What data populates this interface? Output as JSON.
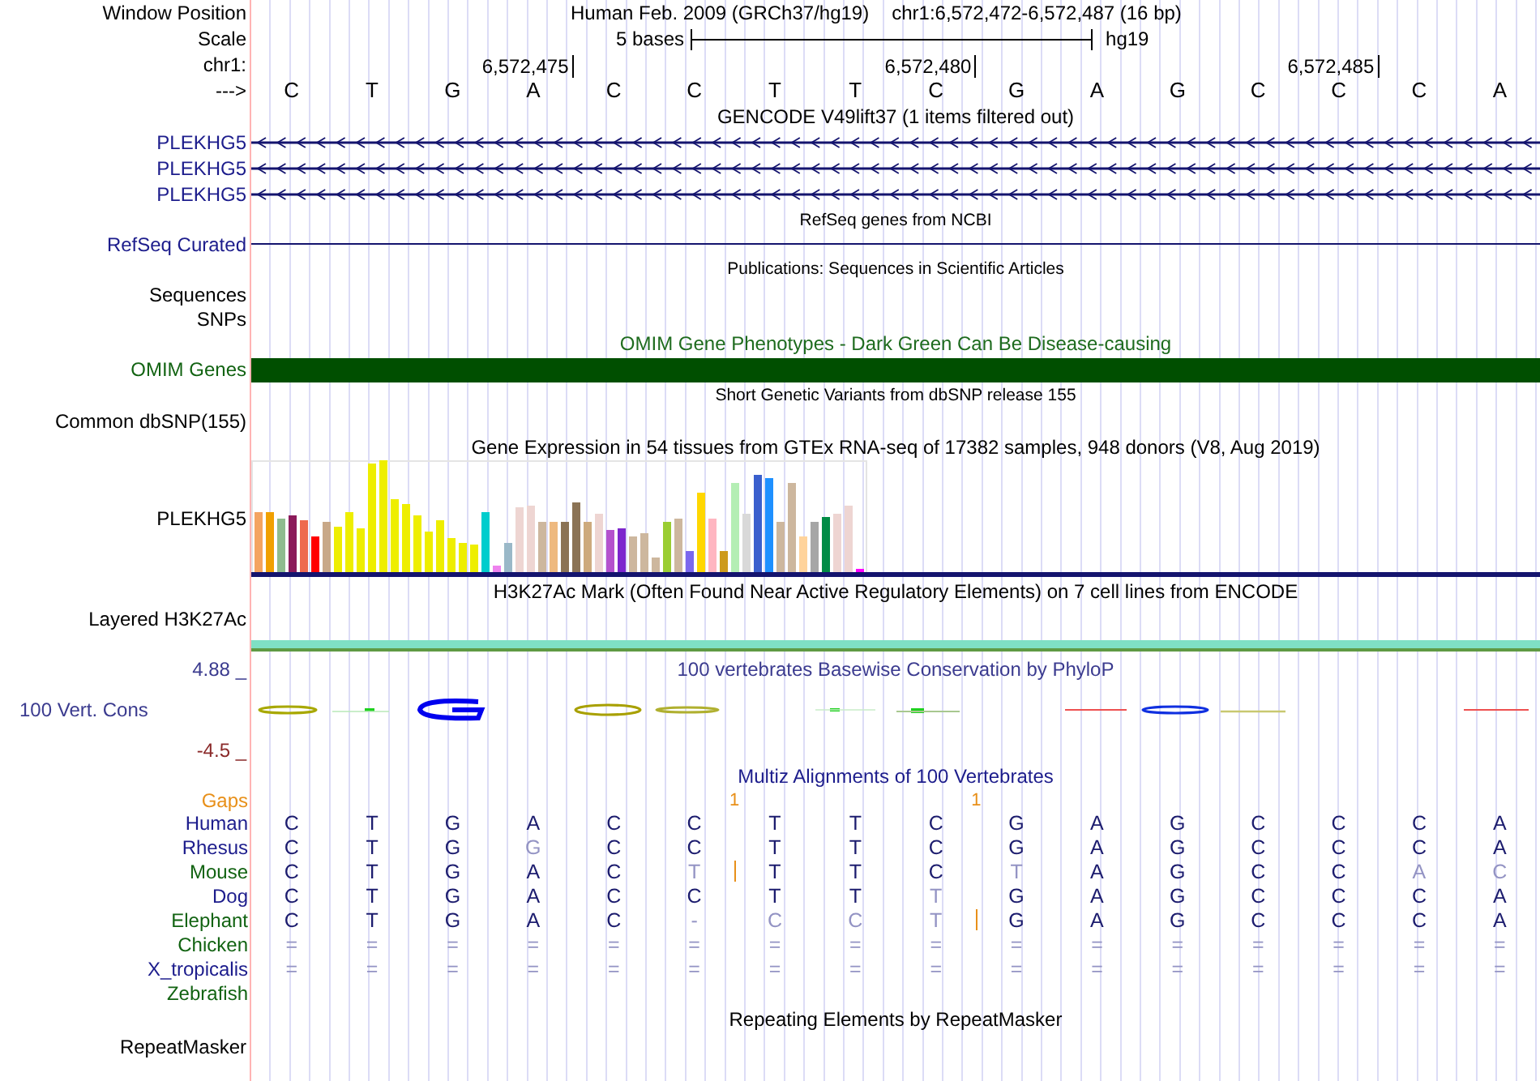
{
  "header": {
    "label": "Window Position",
    "assembly": "Human Feb. 2009 (GRCh37/hg19)",
    "range": "chr1:6,572,472-6,572,487 (16 bp)"
  },
  "scale": {
    "label": "Scale",
    "span": "5 bases",
    "assembly": "hg19"
  },
  "coordinates": {
    "label": "chr1:",
    "ticks": [
      "6,572,475",
      "6,572,480",
      "6,572,485"
    ]
  },
  "reference": {
    "label": "--->",
    "bases": [
      "C",
      "T",
      "G",
      "A",
      "C",
      "C",
      "T",
      "T",
      "C",
      "G",
      "A",
      "G",
      "C",
      "C",
      "C",
      "A"
    ]
  },
  "gencode": {
    "title": "GENCODE V49lift37 (1 items filtered out)",
    "transcripts": [
      {
        "name": "PLEKHG5"
      },
      {
        "name": "PLEKHG5"
      },
      {
        "name": "PLEKHG5"
      }
    ]
  },
  "refseq": {
    "title": "RefSeq genes from NCBI",
    "label": "RefSeq Curated"
  },
  "publications": {
    "title": "Publications: Sequences in Scientific Articles",
    "labels": [
      "Sequences",
      "SNPs"
    ]
  },
  "omim": {
    "title": "OMIM Gene Phenotypes - Dark Green Can Be Disease-causing",
    "label": "OMIM Genes"
  },
  "dbsnp": {
    "title": "Short Genetic Variants from dbSNP release 155",
    "label": "Common dbSNP(155)"
  },
  "gtex": {
    "title": "Gene Expression in 54 tissues from GTEx RNA-seq of 17382 samples, 948 donors (V8, Aug 2019)",
    "label": "PLEKHG5"
  },
  "h3k27ac": {
    "title": "H3K27Ac Mark (Often Found Near Active Regulatory Elements) on 7 cell lines from ENCODE",
    "label": "Layered H3K27Ac"
  },
  "phylop": {
    "title": "100 vertebrates Basewise Conservation by PhyloP",
    "label": "100 Vert. Cons",
    "max": "4.88 _",
    "min": "-4.5 _"
  },
  "multiz": {
    "title": "Multiz Alignments of 100 Vertebrates",
    "gaps": {
      "label": "Gaps",
      "color": "#e8901a",
      "marks": [
        "1",
        "1"
      ]
    },
    "species": [
      {
        "name": "Human",
        "color": "#1c1c8c",
        "bases": [
          {
            "b": "C",
            "dim": false,
            "ins": false
          },
          {
            "b": "T",
            "dim": false,
            "ins": false
          },
          {
            "b": "G",
            "dim": false,
            "ins": false
          },
          {
            "b": "A",
            "dim": false,
            "ins": false
          },
          {
            "b": "C",
            "dim": false,
            "ins": false
          },
          {
            "b": "C",
            "dim": false,
            "ins": false
          },
          {
            "b": "T",
            "dim": false,
            "ins": false
          },
          {
            "b": "T",
            "dim": false,
            "ins": false
          },
          {
            "b": "C",
            "dim": false,
            "ins": false
          },
          {
            "b": "G",
            "dim": false,
            "ins": false
          },
          {
            "b": "A",
            "dim": false,
            "ins": false
          },
          {
            "b": "G",
            "dim": false,
            "ins": false
          },
          {
            "b": "C",
            "dim": false,
            "ins": false
          },
          {
            "b": "C",
            "dim": false,
            "ins": false
          },
          {
            "b": "C",
            "dim": false,
            "ins": false
          },
          {
            "b": "A",
            "dim": false,
            "ins": false
          }
        ]
      },
      {
        "name": "Rhesus",
        "color": "#1c1c8c",
        "bases": [
          {
            "b": "C",
            "dim": false,
            "ins": false
          },
          {
            "b": "T",
            "dim": false,
            "ins": false
          },
          {
            "b": "G",
            "dim": false,
            "ins": false
          },
          {
            "b": "G",
            "dim": true,
            "ins": false
          },
          {
            "b": "C",
            "dim": false,
            "ins": false
          },
          {
            "b": "C",
            "dim": false,
            "ins": false
          },
          {
            "b": "T",
            "dim": false,
            "ins": false
          },
          {
            "b": "T",
            "dim": false,
            "ins": false
          },
          {
            "b": "C",
            "dim": false,
            "ins": false
          },
          {
            "b": "G",
            "dim": false,
            "ins": false
          },
          {
            "b": "A",
            "dim": false,
            "ins": false
          },
          {
            "b": "G",
            "dim": false,
            "ins": false
          },
          {
            "b": "C",
            "dim": false,
            "ins": false
          },
          {
            "b": "C",
            "dim": false,
            "ins": false
          },
          {
            "b": "C",
            "dim": false,
            "ins": false
          },
          {
            "b": "A",
            "dim": false,
            "ins": false
          }
        ]
      },
      {
        "name": "Mouse",
        "color": "#126312",
        "bases": [
          {
            "b": "C",
            "dim": false,
            "ins": false
          },
          {
            "b": "T",
            "dim": false,
            "ins": false
          },
          {
            "b": "G",
            "dim": false,
            "ins": false
          },
          {
            "b": "A",
            "dim": false,
            "ins": false
          },
          {
            "b": "C",
            "dim": false,
            "ins": false
          },
          {
            "b": "T",
            "dim": true,
            "ins": true
          },
          {
            "b": "T",
            "dim": false,
            "ins": false
          },
          {
            "b": "T",
            "dim": false,
            "ins": false
          },
          {
            "b": "C",
            "dim": false,
            "ins": false
          },
          {
            "b": "T",
            "dim": true,
            "ins": false
          },
          {
            "b": "A",
            "dim": false,
            "ins": false
          },
          {
            "b": "G",
            "dim": false,
            "ins": false
          },
          {
            "b": "C",
            "dim": false,
            "ins": false
          },
          {
            "b": "C",
            "dim": false,
            "ins": false
          },
          {
            "b": "A",
            "dim": true,
            "ins": false
          },
          {
            "b": "C",
            "dim": true,
            "ins": false
          }
        ]
      },
      {
        "name": "Dog",
        "color": "#1c1c8c",
        "bases": [
          {
            "b": "C",
            "dim": false,
            "ins": false
          },
          {
            "b": "T",
            "dim": false,
            "ins": false
          },
          {
            "b": "G",
            "dim": false,
            "ins": false
          },
          {
            "b": "A",
            "dim": false,
            "ins": false
          },
          {
            "b": "C",
            "dim": false,
            "ins": false
          },
          {
            "b": "C",
            "dim": false,
            "ins": false
          },
          {
            "b": "T",
            "dim": false,
            "ins": false
          },
          {
            "b": "T",
            "dim": false,
            "ins": false
          },
          {
            "b": "T",
            "dim": true,
            "ins": false
          },
          {
            "b": "G",
            "dim": false,
            "ins": false
          },
          {
            "b": "A",
            "dim": false,
            "ins": false
          },
          {
            "b": "G",
            "dim": false,
            "ins": false
          },
          {
            "b": "C",
            "dim": false,
            "ins": false
          },
          {
            "b": "C",
            "dim": false,
            "ins": false
          },
          {
            "b": "C",
            "dim": false,
            "ins": false
          },
          {
            "b": "A",
            "dim": false,
            "ins": false
          }
        ]
      },
      {
        "name": "Elephant",
        "color": "#126312",
        "bases": [
          {
            "b": "C",
            "dim": false,
            "ins": false
          },
          {
            "b": "T",
            "dim": false,
            "ins": false
          },
          {
            "b": "G",
            "dim": false,
            "ins": false
          },
          {
            "b": "A",
            "dim": false,
            "ins": false
          },
          {
            "b": "C",
            "dim": false,
            "ins": false
          },
          {
            "b": "-",
            "dim": true,
            "ins": false
          },
          {
            "b": "C",
            "dim": true,
            "ins": false
          },
          {
            "b": "C",
            "dim": true,
            "ins": false
          },
          {
            "b": "T",
            "dim": true,
            "ins": true
          },
          {
            "b": "G",
            "dim": false,
            "ins": false
          },
          {
            "b": "A",
            "dim": false,
            "ins": false
          },
          {
            "b": "G",
            "dim": false,
            "ins": false
          },
          {
            "b": "C",
            "dim": false,
            "ins": false
          },
          {
            "b": "C",
            "dim": false,
            "ins": false
          },
          {
            "b": "C",
            "dim": false,
            "ins": false
          },
          {
            "b": "A",
            "dim": false,
            "ins": false
          }
        ]
      },
      {
        "name": "Chicken",
        "color": "#126312",
        "bases": [
          {
            "b": "=",
            "dim": true,
            "ins": false
          },
          {
            "b": "=",
            "dim": true,
            "ins": false
          },
          {
            "b": "=",
            "dim": true,
            "ins": false
          },
          {
            "b": "=",
            "dim": true,
            "ins": false
          },
          {
            "b": "=",
            "dim": true,
            "ins": false
          },
          {
            "b": "=",
            "dim": true,
            "ins": false
          },
          {
            "b": "=",
            "dim": true,
            "ins": false
          },
          {
            "b": "=",
            "dim": true,
            "ins": false
          },
          {
            "b": "=",
            "dim": true,
            "ins": false
          },
          {
            "b": "=",
            "dim": true,
            "ins": false
          },
          {
            "b": "=",
            "dim": true,
            "ins": false
          },
          {
            "b": "=",
            "dim": true,
            "ins": false
          },
          {
            "b": "=",
            "dim": true,
            "ins": false
          },
          {
            "b": "=",
            "dim": true,
            "ins": false
          },
          {
            "b": "=",
            "dim": true,
            "ins": false
          },
          {
            "b": "=",
            "dim": true,
            "ins": false
          }
        ]
      },
      {
        "name": "X_tropicalis",
        "color": "#1c1c8c",
        "bases": [
          {
            "b": "=",
            "dim": true,
            "ins": false
          },
          {
            "b": "=",
            "dim": true,
            "ins": false
          },
          {
            "b": "=",
            "dim": true,
            "ins": false
          },
          {
            "b": "=",
            "dim": true,
            "ins": false
          },
          {
            "b": "=",
            "dim": true,
            "ins": false
          },
          {
            "b": "=",
            "dim": true,
            "ins": false
          },
          {
            "b": "=",
            "dim": true,
            "ins": false
          },
          {
            "b": "=",
            "dim": true,
            "ins": false
          },
          {
            "b": "=",
            "dim": true,
            "ins": false
          },
          {
            "b": "=",
            "dim": true,
            "ins": false
          },
          {
            "b": "=",
            "dim": true,
            "ins": false
          },
          {
            "b": "=",
            "dim": true,
            "ins": false
          },
          {
            "b": "=",
            "dim": true,
            "ins": false
          },
          {
            "b": "=",
            "dim": true,
            "ins": false
          },
          {
            "b": "=",
            "dim": true,
            "ins": false
          },
          {
            "b": "=",
            "dim": true,
            "ins": false
          }
        ]
      },
      {
        "name": "Zebrafish",
        "color": "#126312"
      }
    ]
  },
  "repeatmasker": {
    "title": "Repeating Elements by RepeatMasker",
    "label": "RepeatMasker"
  }
}
